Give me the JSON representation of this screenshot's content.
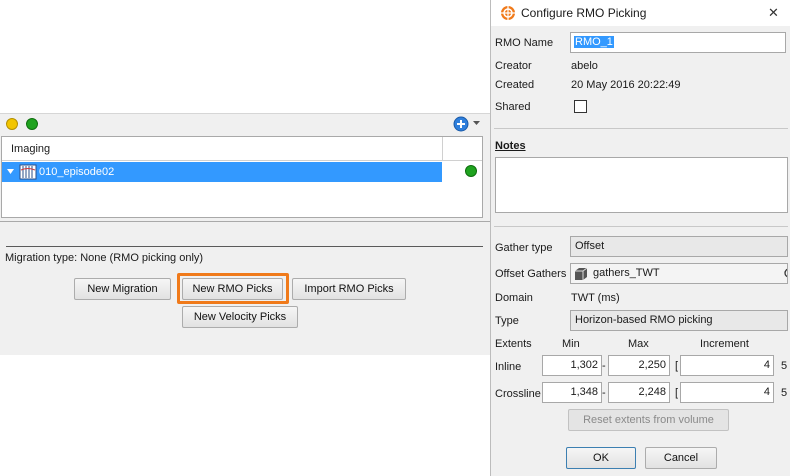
{
  "left_panel": {
    "status_dots": {
      "yellow": "#f2c500",
      "green": "#1fa31f"
    },
    "tree_header": "Imaging",
    "tree_item": "010_episode02",
    "migration_type": "Migration type: None (RMO picking only)",
    "buttons": {
      "new_migration": "New Migration",
      "new_rmo_picks": "New RMO Picks",
      "import_rmo_picks": "Import RMO Picks",
      "new_velocity_picks": "New Velocity Picks"
    },
    "highlight_color": "#f07a1a"
  },
  "dialog": {
    "title": "Configure RMO Picking",
    "close_glyph": "✕",
    "rmo_name_label": "RMO Name",
    "rmo_name_value": "RMO_1",
    "creator_label": "Creator",
    "creator_value": "abelo",
    "created_label": "Created",
    "created_value": "20 May 2016 20:22:49",
    "shared_label": "Shared",
    "notes_label": "Notes",
    "gather_type_label": "Gather type",
    "gather_type_value": "Offset",
    "offset_gathers_label": "Offset Gathers",
    "offset_gathers_value": "gathers_TWT",
    "domain_label": "Domain",
    "domain_value": "TWT (ms)",
    "type_label": "Type",
    "type_value": "Horizon-based RMO picking",
    "extents_label": "Extents",
    "col_min": "Min",
    "col_max": "Max",
    "col_increment": "Increment",
    "inline_label": "Inline",
    "inline_min": "1,302",
    "inline_max": "2,250",
    "inline_increment": "4",
    "crossline_label": "Crossline",
    "crossline_min": "1,348",
    "crossline_max": "2,248",
    "crossline_increment": "4",
    "dash": "-",
    "bracket": "[",
    "trailing_inline": "5",
    "trailing_crossline": "5",
    "reset_extents_label": "Reset extents from volume",
    "ok_label": "OK",
    "cancel_label": "Cancel"
  }
}
